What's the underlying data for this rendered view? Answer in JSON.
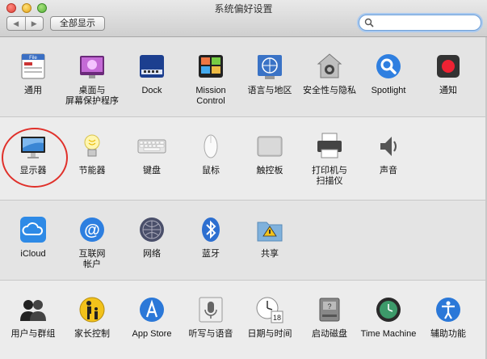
{
  "window": {
    "title": "系统偏好设置"
  },
  "toolbar": {
    "back": "◀",
    "forward": "▶",
    "show_all": "全部显示"
  },
  "search": {
    "value": "",
    "placeholder": ""
  },
  "rows": [
    [
      {
        "id": "general",
        "label": "通用",
        "icon": "general-icon"
      },
      {
        "id": "desktop",
        "label": "桌面与\n屏幕保护程序",
        "icon": "desktop-icon"
      },
      {
        "id": "dock",
        "label": "Dock",
        "icon": "dock-icon"
      },
      {
        "id": "mission",
        "label": "Mission\nControl",
        "icon": "mission-control-icon"
      },
      {
        "id": "language",
        "label": "语言与地区",
        "icon": "language-icon"
      },
      {
        "id": "security",
        "label": "安全性与隐私",
        "icon": "security-icon"
      },
      {
        "id": "spotlight",
        "label": "Spotlight",
        "icon": "spotlight-icon"
      },
      {
        "id": "notifications",
        "label": "通知",
        "icon": "notifications-icon"
      }
    ],
    [
      {
        "id": "displays",
        "label": "显示器",
        "icon": "display-icon"
      },
      {
        "id": "energy",
        "label": "节能器",
        "icon": "energy-icon"
      },
      {
        "id": "keyboard",
        "label": "键盘",
        "icon": "keyboard-icon"
      },
      {
        "id": "mouse",
        "label": "鼠标",
        "icon": "mouse-icon"
      },
      {
        "id": "trackpad",
        "label": "触控板",
        "icon": "trackpad-icon"
      },
      {
        "id": "printers",
        "label": "打印机与\n扫描仪",
        "icon": "printer-icon"
      },
      {
        "id": "sound",
        "label": "声音",
        "icon": "sound-icon"
      }
    ],
    [
      {
        "id": "icloud",
        "label": "iCloud",
        "icon": "icloud-icon"
      },
      {
        "id": "internet",
        "label": "互联网\n帐户",
        "icon": "internet-accounts-icon"
      },
      {
        "id": "network",
        "label": "网络",
        "icon": "network-icon"
      },
      {
        "id": "bluetooth",
        "label": "蓝牙",
        "icon": "bluetooth-icon"
      },
      {
        "id": "sharing",
        "label": "共享",
        "icon": "sharing-icon"
      }
    ],
    [
      {
        "id": "users",
        "label": "用户与群组",
        "icon": "users-icon"
      },
      {
        "id": "parental",
        "label": "家长控制",
        "icon": "parental-controls-icon"
      },
      {
        "id": "appstore",
        "label": "App Store",
        "icon": "app-store-icon"
      },
      {
        "id": "dictation",
        "label": "听写与语音",
        "icon": "dictation-icon"
      },
      {
        "id": "datetime",
        "label": "日期与时间",
        "icon": "date-time-icon"
      },
      {
        "id": "startup",
        "label": "启动磁盘",
        "icon": "startup-disk-icon"
      },
      {
        "id": "timemachine",
        "label": "Time Machine",
        "icon": "time-machine-icon"
      },
      {
        "id": "accessibility",
        "label": "辅助功能",
        "icon": "accessibility-icon"
      }
    ]
  ],
  "icon_text": {
    "general": "File",
    "datetime": "18"
  }
}
